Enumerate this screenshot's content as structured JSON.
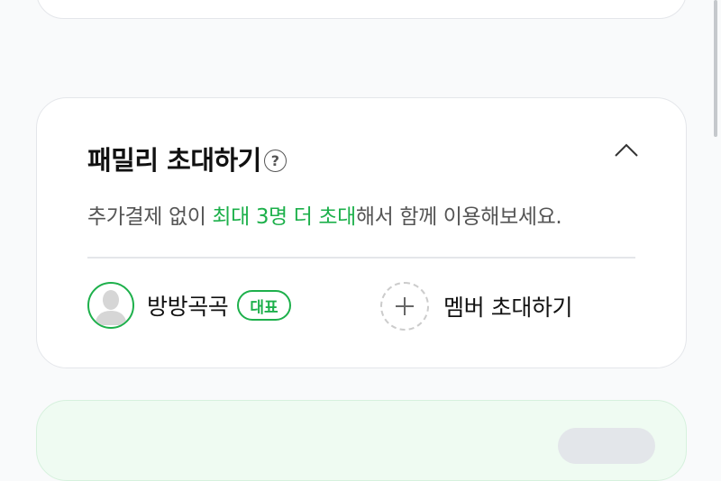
{
  "family_card": {
    "title": "패밀리 초대하기",
    "help_symbol": "?",
    "description": {
      "prefix": "추가결제 없이 ",
      "highlight": "최대 3명 더 초대",
      "suffix": "해서 함께 이용해보세요."
    },
    "members": [
      {
        "name": "방방곡곡",
        "badge": "대표"
      }
    ],
    "invite_label": "멤버 초대하기"
  },
  "icons": {
    "help": "question-circle-icon",
    "collapse": "chevron-up-icon",
    "avatar": "default-user-avatar-icon",
    "add": "plus-icon"
  },
  "colors": {
    "accent": "#1db04b",
    "page_background": "#f9fafb",
    "card_border": "#e4e6ea",
    "promo_background": "#effbf2"
  }
}
